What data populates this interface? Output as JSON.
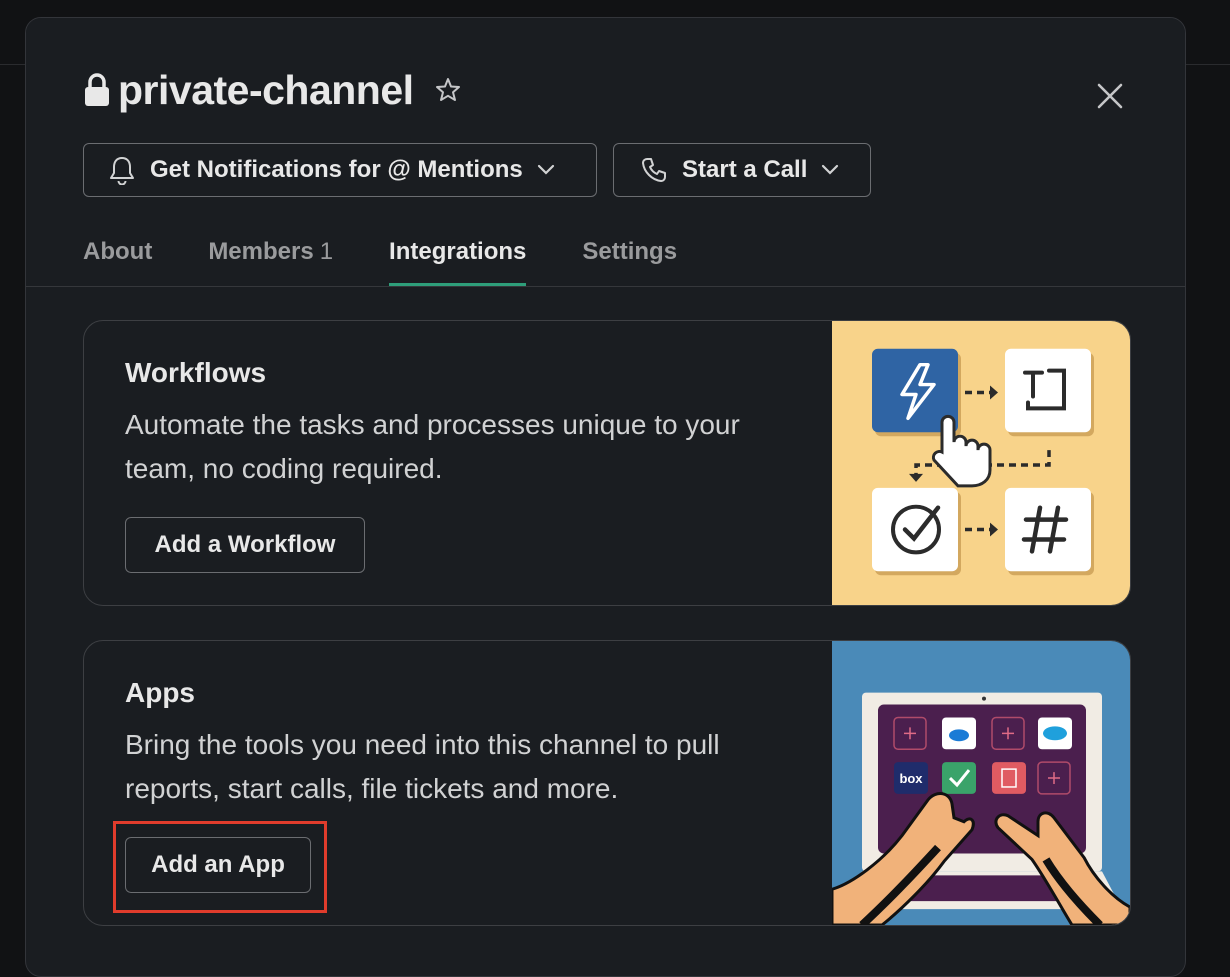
{
  "channel": {
    "name": "private-channel"
  },
  "header": {
    "notifications_label": "Get Notifications for @ Mentions",
    "call_label": "Start a Call"
  },
  "tabs": [
    {
      "label": "About"
    },
    {
      "label": "Members",
      "count": "1"
    },
    {
      "label": "Integrations",
      "active": true
    },
    {
      "label": "Settings"
    }
  ],
  "workflows": {
    "title": "Workflows",
    "description": "Automate the tasks and processes unique to your team, no coding required.",
    "button": "Add a Workflow"
  },
  "apps": {
    "title": "Apps",
    "description": "Bring the tools you need into this channel to pull reports, start calls, file tickets and more.",
    "button": "Add an App",
    "app_icons": [
      "box"
    ]
  },
  "colors": {
    "accent_tab": "#2e9e7a",
    "highlight": "#e03c2c",
    "workflow_bg": "#f8d38a",
    "apps_bg": "#4a8ab8"
  }
}
